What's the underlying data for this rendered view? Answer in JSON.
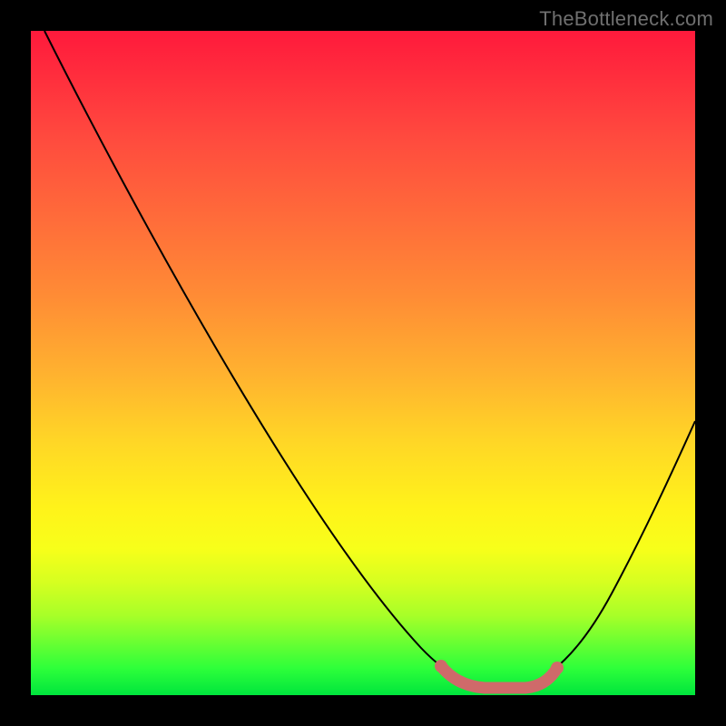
{
  "attribution": "TheBottleneck.com",
  "colors": {
    "frame": "#000000",
    "gradient_top": "#ff1a3c",
    "gradient_mid": "#ffd726",
    "gradient_bottom": "#00e53d",
    "curve": "#000000",
    "worm": "#cf6a6a"
  },
  "chart_data": {
    "type": "line",
    "title": "",
    "xlabel": "",
    "ylabel": "",
    "xlim": [
      0,
      100
    ],
    "ylim": [
      0,
      100
    ],
    "grid": false,
    "legend": false,
    "series": [
      {
        "name": "curve",
        "x": [
          2,
          10,
          20,
          30,
          40,
          50,
          58,
          62,
          66,
          70,
          74,
          78,
          84,
          90,
          96,
          100
        ],
        "y": [
          100,
          86,
          70,
          54,
          39,
          24,
          12,
          6,
          2,
          1,
          1,
          2,
          8,
          18,
          32,
          42
        ]
      },
      {
        "name": "flat-zone",
        "x": [
          62,
          66,
          70,
          74,
          78
        ],
        "y": [
          2,
          1,
          0.5,
          1,
          2
        ]
      }
    ],
    "annotations": []
  }
}
